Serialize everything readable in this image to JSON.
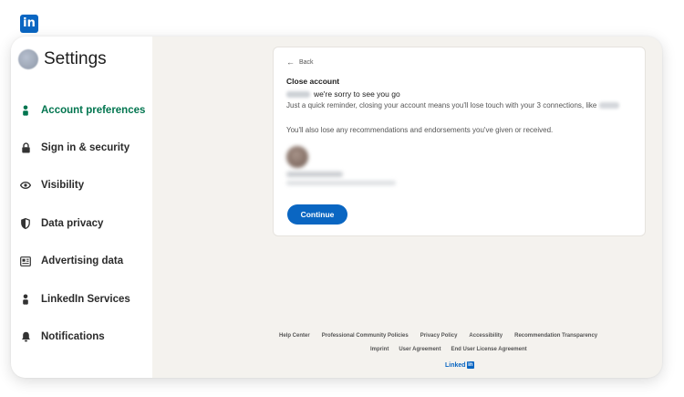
{
  "app": {
    "logo_text": "in",
    "brand_color": "#0a66c2",
    "active_color": "#01754f"
  },
  "sidebar": {
    "title": "Settings",
    "items": [
      {
        "label": "Account preferences",
        "icon": "person-icon",
        "active": true
      },
      {
        "label": "Sign in & security",
        "icon": "lock-icon",
        "active": false
      },
      {
        "label": "Visibility",
        "icon": "eye-icon",
        "active": false
      },
      {
        "label": "Data privacy",
        "icon": "shield-icon",
        "active": false
      },
      {
        "label": "Advertising data",
        "icon": "newspaper-icon",
        "active": false
      },
      {
        "label": "LinkedIn Services",
        "icon": "person-icon",
        "active": false
      },
      {
        "label": "Notifications",
        "icon": "bell-icon",
        "active": false
      }
    ]
  },
  "card": {
    "back_label": "Back",
    "title": "Close account",
    "sorry_text": "we're sorry to see you go",
    "reminder_text": "Just a quick reminder, closing your account means you'll lose touch with your 3 connections, like",
    "also_text": "You'll also lose any recommendations and endorsements you've given or received.",
    "continue_label": "Continue"
  },
  "footer": {
    "row1": [
      "Help Center",
      "Professional Community Policies",
      "Privacy Policy",
      "Accessibility",
      "Recommendation Transparency"
    ],
    "row2": [
      "Imprint",
      "User Agreement",
      "End User License Agreement"
    ],
    "logo_word": "Linked",
    "logo_box": "in"
  }
}
